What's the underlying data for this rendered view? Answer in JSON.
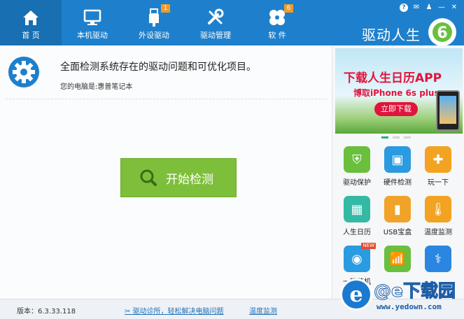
{
  "app": {
    "brand": "驱动人生"
  },
  "nav": [
    {
      "label": "首 页",
      "icon": "home-icon",
      "active": true
    },
    {
      "label": "本机驱动",
      "icon": "monitor-icon"
    },
    {
      "label": "外设驱动",
      "icon": "usb-icon",
      "badge": "1"
    },
    {
      "label": "驱动管理",
      "icon": "tools-icon"
    },
    {
      "label": "软 件",
      "icon": "pinwheel-icon",
      "badge": "6"
    }
  ],
  "window_controls": [
    "help-icon",
    "message-icon",
    "skin-icon",
    "minimize-icon",
    "close-icon"
  ],
  "main": {
    "title": "全面检测系统存在的驱动问题和可优化项目。",
    "subtitle": "您的电脑是:惠普笔记本",
    "scan_button": "开始检测"
  },
  "ad": {
    "title": "下载人生日历APP",
    "subtitle": "博取iPhone 6s plus",
    "button": "立即下载"
  },
  "tools": [
    {
      "label": "驱动保护",
      "icon": "shield-icon",
      "color": "#6abf3d"
    },
    {
      "label": "硬件检测",
      "icon": "hardware-icon",
      "color": "#2a9be0"
    },
    {
      "label": "玩一下",
      "icon": "gamepad-icon",
      "color": "#f2a321"
    },
    {
      "label": "人生日历",
      "icon": "calendar-icon",
      "color": "#34b9a5"
    },
    {
      "label": "USB宝盒",
      "icon": "usb-box-icon",
      "color": "#f0a326"
    },
    {
      "label": "温度监测",
      "icon": "thermometer-icon",
      "color": "#f2a321"
    },
    {
      "label": "一键装机",
      "icon": "install-icon",
      "color": "#2a9be0",
      "new": "NEW"
    },
    {
      "label": "",
      "icon": "wifi-icon",
      "color": "#6abf3d"
    },
    {
      "label": "",
      "icon": "doctor-icon",
      "color": "#2a86e0"
    }
  ],
  "status": {
    "version": "版本：6.3.33.118",
    "diagnose": "驱动诊所，轻松解决电脑问题",
    "temperature": "温度监测"
  },
  "watermark": {
    "text": "@e下载园",
    "url": "www.yedown.com"
  }
}
